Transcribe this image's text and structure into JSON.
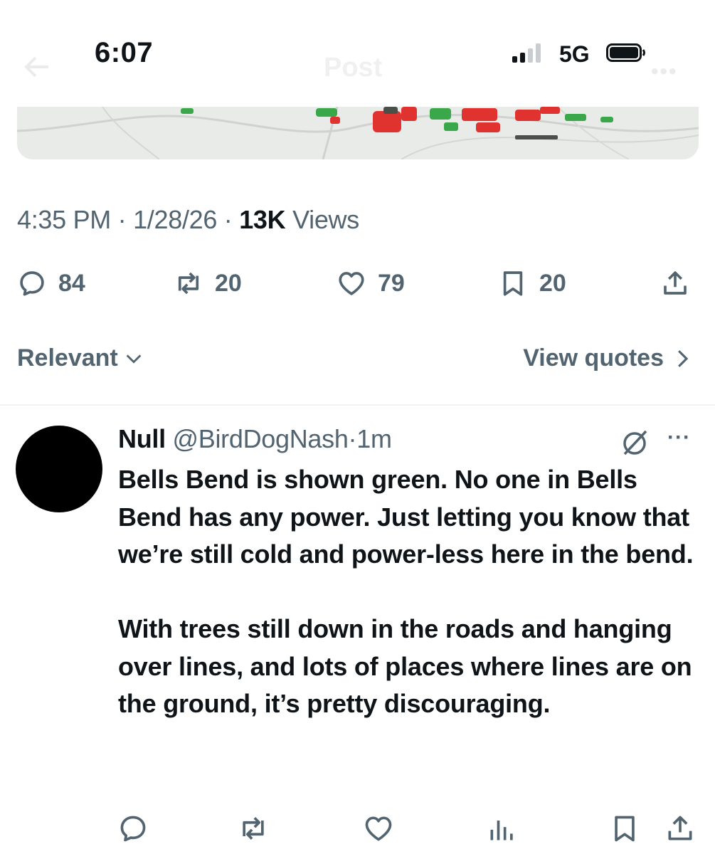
{
  "status_bar": {
    "time": "6:07",
    "network": "5G",
    "signal_bars": 4,
    "signal_active_bars": 2,
    "battery_level": 0.9
  },
  "nav": {
    "title": "Post",
    "back_icon": "back-arrow-icon",
    "more_icon": "more-icon"
  },
  "post": {
    "map_colors": {
      "base": "#e7e9e7",
      "outage": "#e0322f",
      "restored": "#3aa84a",
      "road": "#c9ccc8"
    },
    "time": "4:35 PM",
    "date": "1/28/26",
    "views_count": "13K",
    "views_label": "Views",
    "separator": "·",
    "actions": {
      "replies": "84",
      "reposts": "20",
      "likes": "79",
      "bookmarks": "20"
    }
  },
  "sort": {
    "label": "Relevant",
    "view_quotes": "View quotes"
  },
  "reply": {
    "name": "Null",
    "handle": "@BirdDogNash",
    "separator": "·",
    "time": "1m",
    "more": "···",
    "paragraph_1": "Bells Bend is shown green. No one in Bells Bend has any power. Just letting you know that we’re still cold and power-less here in the bend.",
    "paragraph_2": "With trees still down in the roads and hanging over lines, and lots of places where lines are on the ground, it’s pretty discouraging."
  },
  "colors": {
    "text": "#0f1419",
    "secondary": "#536471",
    "divider": "#eff3f4"
  }
}
